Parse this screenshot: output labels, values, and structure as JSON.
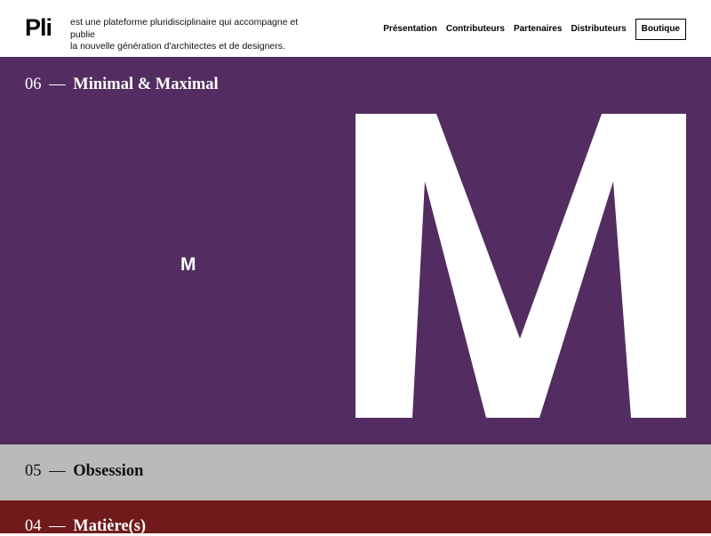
{
  "header": {
    "logo": "Pli",
    "tagline_line1": "est une plateforme pluridisciplinaire qui accompagne et publie",
    "tagline_line2": "la nouvelle génération d'architectes et de designers.",
    "nav": [
      "Présentation",
      "Contributeurs",
      "Partenaires",
      "Distributeurs"
    ],
    "shop_button": "Boutique"
  },
  "sections": [
    {
      "number": "06",
      "dash": "—",
      "title": "Minimal & Maximal",
      "background": "#532d62",
      "cover_letter_small": "M",
      "cover_letter_large": "M"
    },
    {
      "number": "05",
      "dash": "—",
      "title": "Obsession",
      "background": "#bababa"
    },
    {
      "number": "04",
      "dash": "—",
      "title": "Matière(s)",
      "background": "#711a1c"
    }
  ]
}
